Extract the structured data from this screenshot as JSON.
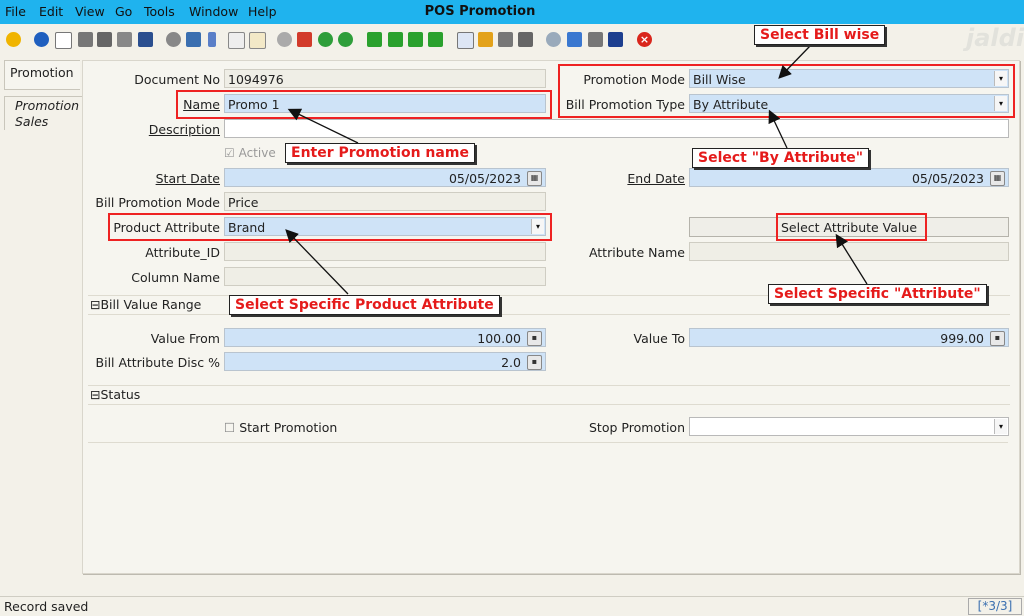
{
  "menu": [
    "File",
    "Edit",
    "View",
    "Go",
    "Tools",
    "Window",
    "Help"
  ],
  "window_title": "POS Promotion",
  "watermark": "jaldi",
  "tabs": [
    "Promotion",
    "Promotion Sales"
  ],
  "form": {
    "document_no": {
      "label": "Document No",
      "value": "1094976"
    },
    "name": {
      "label": "Name",
      "value": "Promo 1"
    },
    "description": {
      "label": "Description",
      "value": ""
    },
    "active": {
      "label": "Active",
      "checked": true
    },
    "start_date": {
      "label": "Start Date",
      "value": "05/05/2023"
    },
    "bill_promotion_mode": {
      "label": "Bill Promotion Mode",
      "value": "Price"
    },
    "product_attribute": {
      "label": "Product Attribute",
      "value": "Brand"
    },
    "attribute_id": {
      "label": "Attribute_ID",
      "value": ""
    },
    "column_name": {
      "label": "Column Name",
      "value": ""
    },
    "promotion_mode": {
      "label": "Promotion Mode",
      "value": "Bill Wise"
    },
    "bill_promotion_type": {
      "label": "Bill Promotion Type",
      "value": "By Attribute"
    },
    "end_date": {
      "label": "End Date",
      "value": "05/05/2023"
    },
    "select_attribute_value": {
      "label": "Select Attribute Value"
    },
    "attribute_name": {
      "label": "Attribute Name",
      "value": ""
    },
    "bill_value_range": {
      "label": "Bill Value Range"
    },
    "value_from": {
      "label": "Value From",
      "value": "100.00"
    },
    "bill_attribute_disc": {
      "label": "Bill Attribute Disc %",
      "value": "2.0"
    },
    "value_to": {
      "label": "Value To",
      "value": "999.00"
    },
    "status": {
      "label": "Status"
    },
    "start_promotion": {
      "label": "Start Promotion",
      "checked": false
    },
    "stop_promotion": {
      "label": "Stop Promotion",
      "value": ""
    }
  },
  "annotations": {
    "select_bill_wise": "Select Bill wise",
    "enter_promotion_name": "Enter Promotion name",
    "select_by_attribute": "Select \"By Attribute\"",
    "select_specific_attribute": "Select Specific \"Attribute\"",
    "select_specific_product_attribute": "Select Specific Product Attribute"
  },
  "statusbar": {
    "message": "Record saved",
    "record": "[*3/3]"
  },
  "colors": {
    "title_bar": "#1fb3ee",
    "field_bg": "#cfe3f7",
    "annotation_red": "#e51b1b"
  }
}
